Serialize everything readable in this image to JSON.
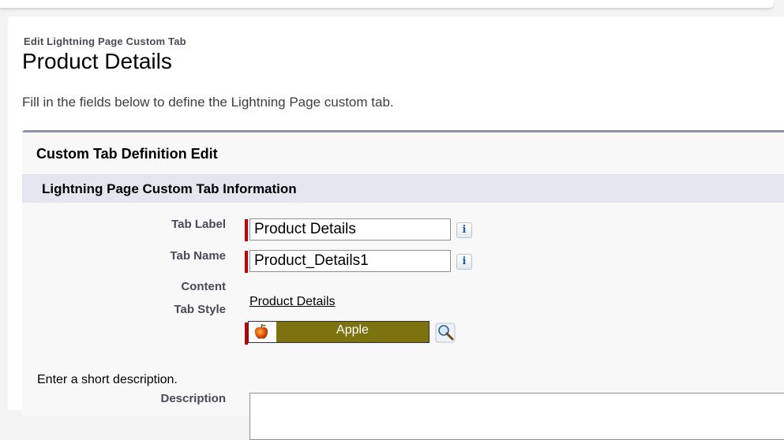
{
  "header": {
    "page_type": "Edit Lightning Page Custom Tab",
    "title": "Product Details",
    "description": "Fill in the fields below to define the Lightning Page custom tab."
  },
  "block": {
    "title": "Custom Tab Definition Edit",
    "section_title": "Lightning Page Custom Tab Information"
  },
  "fields": {
    "tab_label": {
      "label": "Tab Label",
      "value": "Product Details",
      "info_icon": "i"
    },
    "tab_name": {
      "label": "Tab Name",
      "value": "Product_Details1",
      "info_icon": "i"
    },
    "content": {
      "label": "Content",
      "value": "Product Details"
    },
    "tab_style": {
      "label": "Tab Style",
      "value": "Apple",
      "icon": "apple-icon",
      "color": "#7c7310"
    },
    "description": {
      "hint": "Enter a short description.",
      "label": "Description",
      "value": ""
    }
  },
  "colors": {
    "required": "#c00000",
    "section_bar": "#e3e6ee",
    "block_border": "#8b94a8"
  }
}
